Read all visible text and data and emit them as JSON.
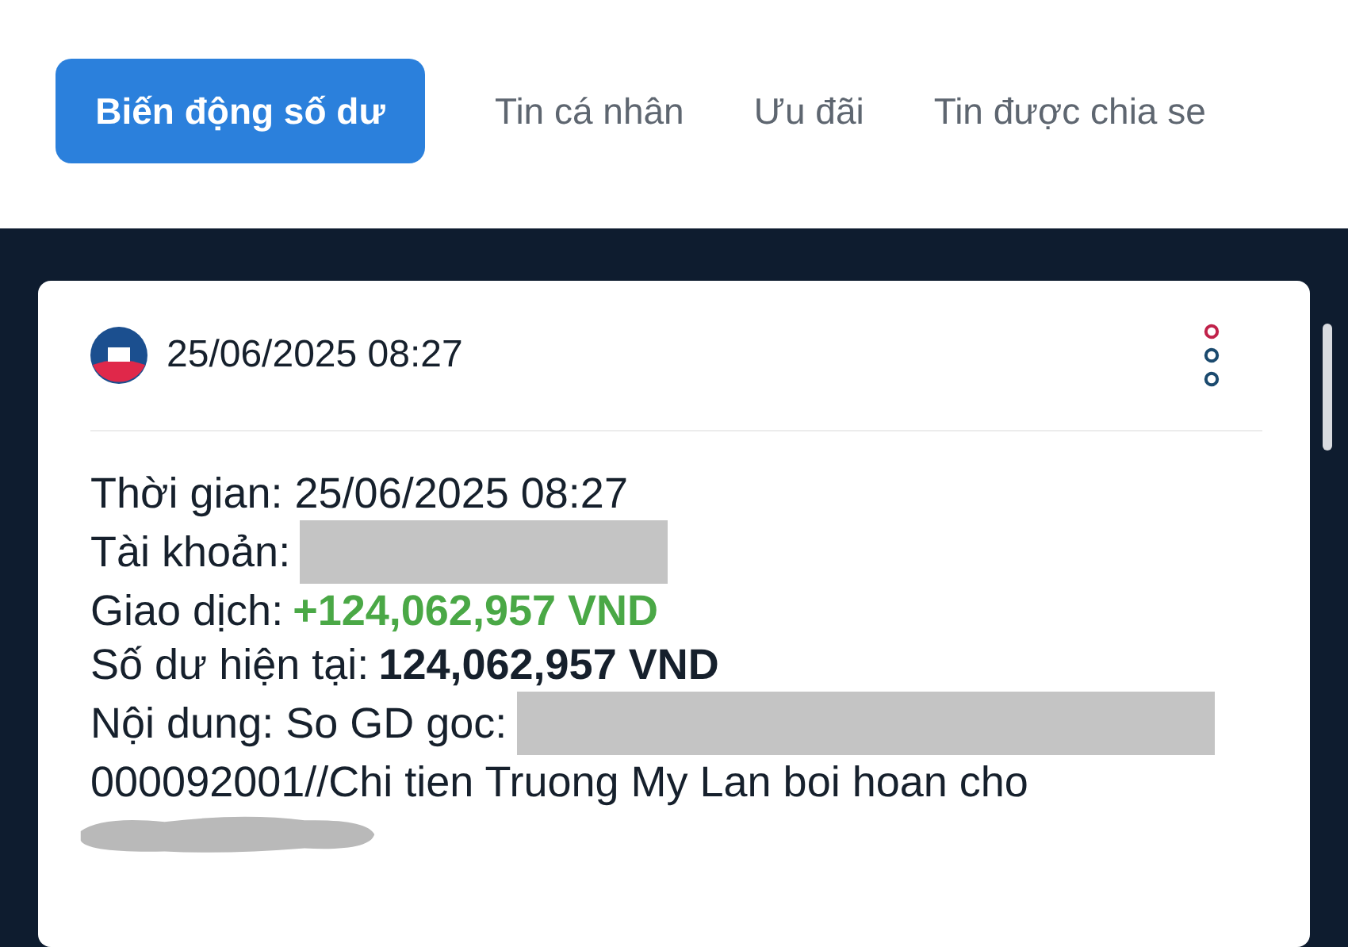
{
  "tabs": [
    {
      "label": "Biến động số dư",
      "selected": true
    },
    {
      "label": "Tin cá nhân",
      "selected": false
    },
    {
      "label": "Ưu đãi",
      "selected": false
    },
    {
      "label": "Tin được chia se",
      "selected": false
    }
  ],
  "notification": {
    "time": "25/06/2025 08:27",
    "lines": [
      {
        "label": "Thời gian:",
        "value": "25/06/2025 08:27",
        "kind": "plain"
      },
      {
        "label": "Tài khoản:",
        "kind": "redacted"
      },
      {
        "label": "Giao dịch:",
        "value": "+124,062,957 VND",
        "kind": "credit"
      },
      {
        "label": "Số dư hiện tại:",
        "value": "124,062,957 VND",
        "kind": "balance"
      },
      {
        "label": "Nội dung: So GD goc:",
        "kind": "redacted_wide"
      }
    ],
    "continuation": "000092001//Chi tien Truong My Lan boi hoan cho"
  }
}
